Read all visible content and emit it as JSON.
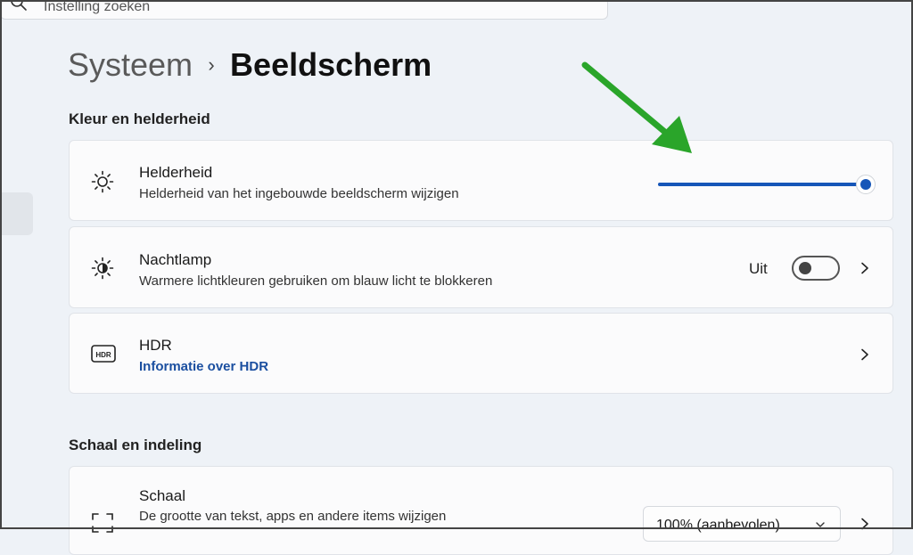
{
  "search": {
    "placeholder": "Instelling zoeken",
    "icon": "search-icon"
  },
  "breadcrumb": {
    "parent": "Systeem",
    "separator": "›",
    "current": "Beeldscherm"
  },
  "sections": {
    "color": {
      "title": "Kleur en helderheid"
    },
    "scale": {
      "title": "Schaal en indeling"
    }
  },
  "brightness": {
    "title": "Helderheid",
    "description": "Helderheid van het ingebouwde beeldscherm wijzigen",
    "icon": "sun-icon",
    "value_percent": 100
  },
  "nightlight": {
    "title": "Nachtlamp",
    "description": "Warmere lichtkleuren gebruiken om blauw licht te blokkeren",
    "icon": "night-light-icon",
    "state_label": "Uit",
    "enabled": false
  },
  "hdr": {
    "title": "HDR",
    "link": "Informatie over HDR",
    "icon": "hdr-icon"
  },
  "scale": {
    "title": "Schaal",
    "description": "De grootte van tekst, apps en andere items wijzigen",
    "icon": "scale-icon",
    "selected": "100% (aanbevolen)"
  },
  "colors": {
    "accent": "#1656b8",
    "annotation_arrow": "#2aa52a",
    "background": "#eef2f7",
    "card": "#fbfbfc"
  }
}
